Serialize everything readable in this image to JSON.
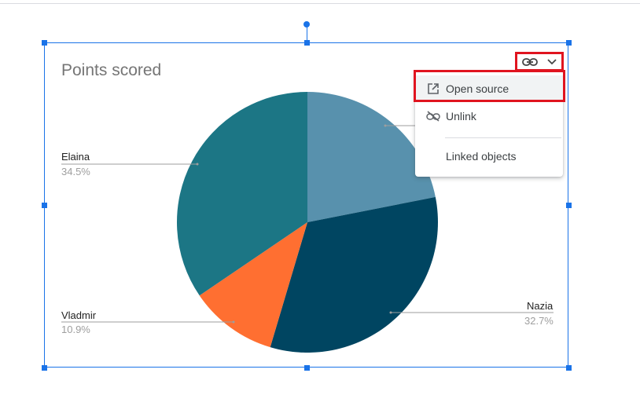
{
  "chart_data": {
    "type": "pie",
    "title": "Points scored",
    "slices": [
      {
        "label": "",
        "percent": 21.9,
        "color": "#5891ad"
      },
      {
        "label": "Nazia",
        "percent": 32.7,
        "color": "#004561"
      },
      {
        "label": "Vladmir",
        "percent": 10.9,
        "color": "#ff6f31"
      },
      {
        "label": "Elaina",
        "percent": 34.5,
        "color": "#1c7685"
      }
    ],
    "legend": "none",
    "data_labels": "outside"
  },
  "labels": {
    "elaina": {
      "name": "Elaina",
      "pct": "34.5%"
    },
    "vladmir": {
      "name": "Vladmir",
      "pct": "10.9%"
    },
    "nazia": {
      "name": "Nazia",
      "pct": "32.7%"
    }
  },
  "link_menu": {
    "icon": "link-icon",
    "dropdown_icon": "chevron-down-icon",
    "items": [
      {
        "label": "Open source",
        "icon": "open-in-new-icon",
        "highlighted": true
      },
      {
        "label": "Unlink",
        "icon": "link-off-icon"
      },
      {
        "label": "Linked objects",
        "icon": ""
      }
    ]
  },
  "colors": {
    "selection": "#1a73e8",
    "highlight_box": "#e0141f"
  }
}
